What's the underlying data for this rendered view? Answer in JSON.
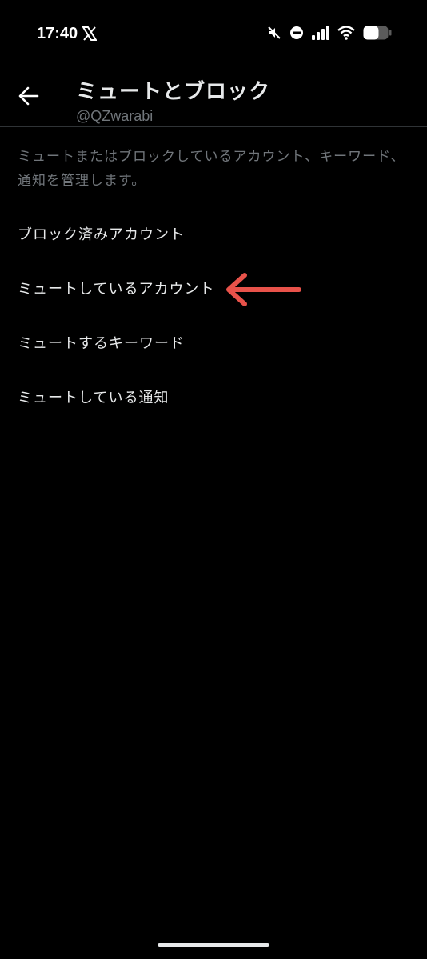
{
  "status_bar": {
    "time": "17:40",
    "icons": [
      "x-logo-icon",
      "mute-icon",
      "dnd-icon",
      "signal-icon",
      "wifi-icon",
      "battery-icon"
    ]
  },
  "header": {
    "title": "ミュートとブロック",
    "subtitle": "@QZwarabi",
    "back_icon": "back-arrow-icon"
  },
  "description": "ミュートまたはブロックしているアカウント、キーワード、通知を管理します。",
  "menu": {
    "items": [
      {
        "label": "ブロック済みアカウント"
      },
      {
        "label": "ミュートしているアカウント"
      },
      {
        "label": "ミュートするキーワード"
      },
      {
        "label": "ミュートしている通知"
      }
    ]
  },
  "annotation": {
    "color": "#e8524a",
    "icon": "red-arrow-annotation"
  },
  "colors": {
    "background": "#000000",
    "primary_text": "#e7e9ea",
    "secondary_text": "#71767b",
    "divider": "#2f3336"
  }
}
